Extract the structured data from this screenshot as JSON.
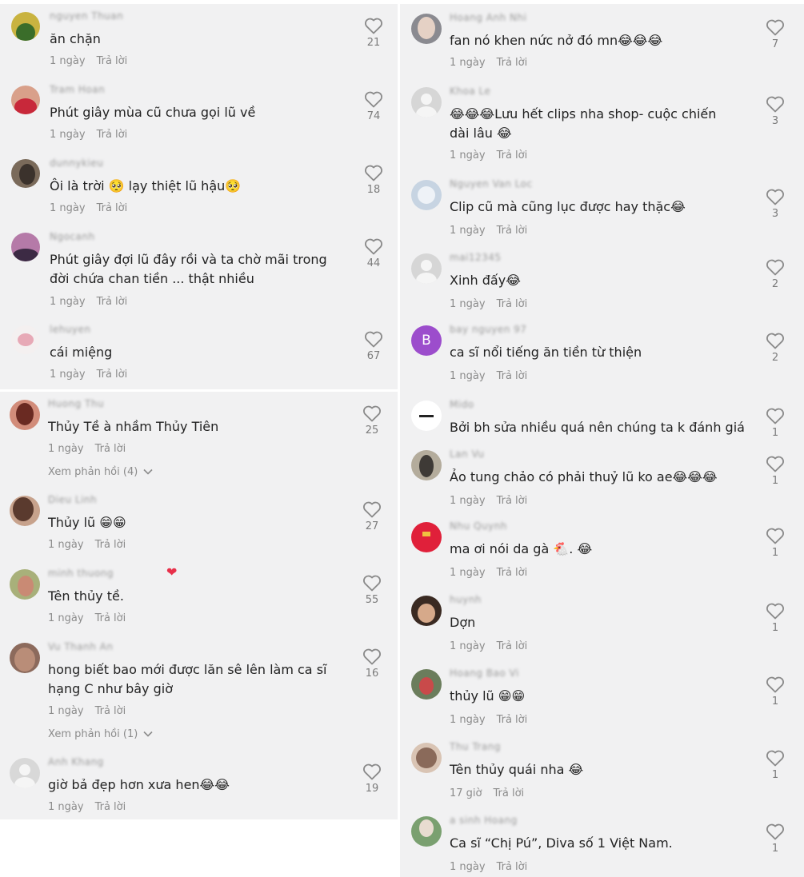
{
  "colors": {
    "panel_bg": "#f1f1f2",
    "meta": "#8b8b8b",
    "text": "#222222"
  },
  "like_icon": "heart-outline-icon",
  "left_top": [
    {
      "user": "nguyen Thuan",
      "text": "ăn chặn",
      "time": "1 ngày",
      "reply": "Trả lời",
      "likes": "21"
    },
    {
      "user": "Tram Hoan",
      "text": "Phút giây mùa cũ chưa gọi lũ về",
      "time": "1 ngày",
      "reply": "Trả lời",
      "likes": "74"
    },
    {
      "user": "dunnykieu",
      "text": "Ôi là trời 🥺 lạy thiệt lũ hậu🥺",
      "time": "1 ngày",
      "reply": "Trả lời",
      "likes": "18"
    },
    {
      "user": "Ngocanh",
      "text": "Phút giây đợi lũ đây rồi và ta chờ mãi trong đời chứa chan tiền ... thật nhiều",
      "time": "1 ngày",
      "reply": "Trả lời",
      "likes": "44"
    },
    {
      "user": "lehuyen",
      "text": "cái miệng",
      "time": "1 ngày",
      "reply": "Trả lời",
      "likes": "67"
    }
  ],
  "left_bottom": [
    {
      "user": "Huong Thu",
      "text": "Thủy Tề à nhầm Thủy Tiên",
      "time": "1 ngày",
      "reply": "Trả lời",
      "likes": "25",
      "view_replies": "Xem phản hồi (4)"
    },
    {
      "user": "Dieu Linh",
      "text": "Thủy lũ 😁😁",
      "time": "1 ngày",
      "reply": "Trả lời",
      "likes": "27"
    },
    {
      "user": "minh thuong",
      "text": "Tên thủy tề.",
      "time": "1 ngày",
      "reply": "Trả lời",
      "likes": "55"
    },
    {
      "user": "Vu Thanh An",
      "text": "hong biết bao mới được lăn sê lên làm ca sĩ hạng C như bây giờ",
      "time": "1 ngày",
      "reply": "Trả lời",
      "likes": "16",
      "view_replies": "Xem phản hồi (1)"
    },
    {
      "user": "Anh Khang",
      "text": "giờ bả đẹp hơn xưa hen😂😂",
      "time": "1 ngày",
      "reply": "Trả lời",
      "likes": "19"
    }
  ],
  "right": [
    {
      "user": "Hoang Anh Nhi",
      "text": "fan nó khen nức nở đó mn😂😂😂",
      "time": "1 ngày",
      "reply": "Trả lời",
      "likes": "7"
    },
    {
      "user": "Khoa Le",
      "text": "😂😂😂Lưu hết clips nha shop- cuộc chiến dài lâu 😂",
      "time": "1 ngày",
      "reply": "Trả lời",
      "likes": "3"
    },
    {
      "user": "Nguyen Van Loc",
      "text": "Clip cũ mà cũng lục được hay thặc😂",
      "time": "1 ngày",
      "reply": "Trả lời",
      "likes": "3"
    },
    {
      "user": "mai12345",
      "text": "Xinh đấy😂",
      "time": "1 ngày",
      "reply": "Trả lời",
      "likes": "2"
    },
    {
      "user": "bay nguyen 97",
      "avatar_letter": "B",
      "text": "ca sĩ nổi tiếng ăn tiền từ thiện",
      "time": "1 ngày",
      "reply": "Trả lời",
      "likes": "2"
    },
    {
      "user": "Mido",
      "text": "Bởi bh sửa nhiều quá nên chúng ta k đánh giá",
      "likes": "1"
    },
    {
      "user": "Lan Vu",
      "text": "Ảo tung chảo có phải thuỷ lũ ko ae😂😂😂",
      "time": "1 ngày",
      "reply": "Trả lời",
      "likes": "1"
    },
    {
      "user": "Nhu Quynh",
      "text": "ma ơi nói da gà 🐔. 😂",
      "time": "1 ngày",
      "reply": "Trả lời",
      "likes": "1"
    },
    {
      "user": "huynh",
      "text": "Dợn",
      "time": "1 ngày",
      "reply": "Trả lời",
      "likes": "1"
    },
    {
      "user": "Hoang Bao Vi",
      "text": "thủy lũ 😁😁",
      "time": "1 ngày",
      "reply": "Trả lời",
      "likes": "1"
    },
    {
      "user": "Thu Trang",
      "text": "Tên thủy quái nha 😂",
      "time": "17 giờ",
      "reply": "Trả lời",
      "likes": "1"
    },
    {
      "user": "a sinh Hoang",
      "text": "Ca sĩ “Chị Pú”, Diva số 1 Việt Nam.",
      "time": "1 ngày",
      "reply": "Trả lời",
      "likes": "1"
    }
  ]
}
